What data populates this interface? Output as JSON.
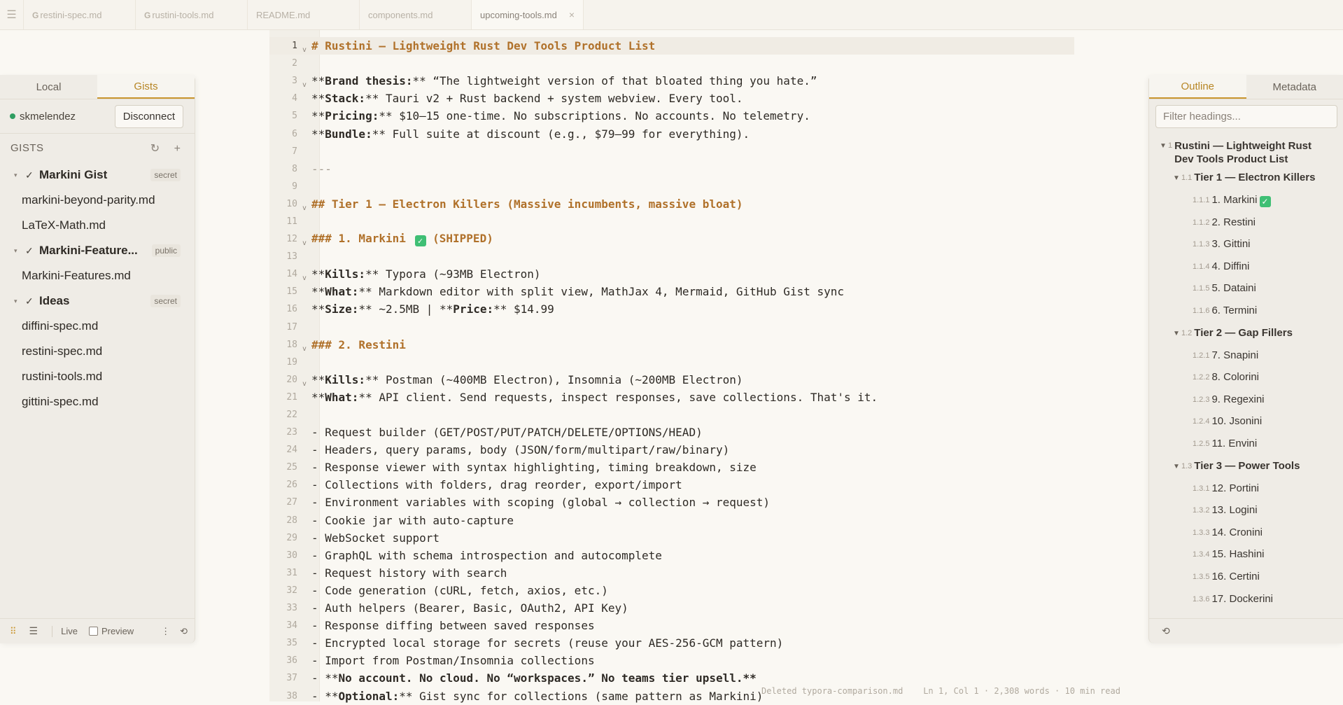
{
  "tabs": [
    {
      "label": "restini-spec.md",
      "gist": true
    },
    {
      "label": "rustini-tools.md",
      "gist": true
    },
    {
      "label": "README.md",
      "gist": false
    },
    {
      "label": "components.md",
      "gist": false
    },
    {
      "label": "upcoming-tools.md",
      "gist": false,
      "active": true
    }
  ],
  "tab_gist_mark": "G",
  "tab_close": "×",
  "left_panel": {
    "tabs": [
      "Local",
      "Gists"
    ],
    "user": "skmelendez",
    "disconnect_label": "Disconnect",
    "gists_title": "GISTS",
    "refresh_icon": "↻",
    "add_icon": "+",
    "groups": [
      {
        "name": "Markini Gist",
        "badge": "secret",
        "files": [
          "markini-beyond-parity.md",
          "LaTeX-Math.md"
        ]
      },
      {
        "name": "Markini-Feature...",
        "badge": "public",
        "files": [
          "Markini-Features.md"
        ]
      },
      {
        "name": "Ideas",
        "badge": "secret",
        "files": [
          "diffini-spec.md",
          "restini-spec.md",
          "rustini-tools.md",
          "gittini-spec.md"
        ]
      }
    ],
    "footer": {
      "live_label": "Live",
      "preview_label": "Preview",
      "more_icon": "⋮"
    }
  },
  "editor": {
    "lines": [
      {
        "t": "h",
        "s": "# Rustini — Lightweight Rust Dev Tools Product List",
        "fold": true
      },
      {
        "t": "p",
        "s": ""
      },
      {
        "t": "kv",
        "k": "Brand thesis:",
        "v": " “The lightweight version of that bloated thing you hate.”",
        "fold": true
      },
      {
        "t": "kv",
        "k": "Stack:",
        "v": " Tauri v2 + Rust backend + system webview. Every tool."
      },
      {
        "t": "kv",
        "k": "Pricing:",
        "v": " $10–15 one-time. No subscriptions. No accounts. No telemetry."
      },
      {
        "t": "kv",
        "k": "Bundle:",
        "v": " Full suite at discount (e.g., $79–99 for everything)."
      },
      {
        "t": "p",
        "s": ""
      },
      {
        "t": "dim",
        "s": "---"
      },
      {
        "t": "p",
        "s": ""
      },
      {
        "t": "h",
        "s": "## Tier 1 — Electron Killers (Massive incumbents, massive bloat)",
        "fold": true
      },
      {
        "t": "p",
        "s": ""
      },
      {
        "t": "hc",
        "a": "### 1. Markini ",
        "b": " (SHIPPED)",
        "fold": true
      },
      {
        "t": "p",
        "s": ""
      },
      {
        "t": "kv",
        "k": "Kills:",
        "v": " Typora (~93MB Electron)",
        "fold": true
      },
      {
        "t": "kv",
        "k": "What:",
        "v": " Markdown editor with split view, MathJax 4, Mermaid, GitHub Gist sync"
      },
      {
        "t": "kv2",
        "k": "Size:",
        "v": " ~2.5MB | ",
        "k2": "Price:",
        "v2": " $14.99"
      },
      {
        "t": "p",
        "s": ""
      },
      {
        "t": "h",
        "s": "### 2. Restini",
        "fold": true
      },
      {
        "t": "p",
        "s": ""
      },
      {
        "t": "kv",
        "k": "Kills:",
        "v": " Postman (~400MB Electron), Insomnia (~200MB Electron)",
        "fold": true
      },
      {
        "t": "kv",
        "k": "What:",
        "v": " API client. Send requests, inspect responses, save collections. That's it."
      },
      {
        "t": "p",
        "s": ""
      },
      {
        "t": "p",
        "s": "- Request builder (GET/POST/PUT/PATCH/DELETE/OPTIONS/HEAD)"
      },
      {
        "t": "p",
        "s": "- Headers, query params, body (JSON/form/multipart/raw/binary)"
      },
      {
        "t": "p",
        "s": "- Response viewer with syntax highlighting, timing breakdown, size"
      },
      {
        "t": "p",
        "s": "- Collections with folders, drag reorder, export/import"
      },
      {
        "t": "p",
        "s": "- Environment variables with scoping (global → collection → request)"
      },
      {
        "t": "p",
        "s": "- Cookie jar with auto-capture"
      },
      {
        "t": "p",
        "s": "- WebSocket support"
      },
      {
        "t": "p",
        "s": "- GraphQL with schema introspection and autocomplete"
      },
      {
        "t": "p",
        "s": "- Request history with search"
      },
      {
        "t": "p",
        "s": "- Code generation (cURL, fetch, axios, etc.)"
      },
      {
        "t": "p",
        "s": "- Auth helpers (Bearer, Basic, OAuth2, API Key)"
      },
      {
        "t": "p",
        "s": "- Response diffing between saved responses"
      },
      {
        "t": "p",
        "s": "- Encrypted local storage for secrets (reuse your AES-256-GCM pattern)"
      },
      {
        "t": "p",
        "s": "- Import from Postman/Insomnia collections"
      },
      {
        "t": "bl",
        "s": "No account. No cloud. No “workspaces.” No teams tier upsell."
      },
      {
        "t": "kvl",
        "k": "Optional:",
        "v": " Gist sync for collections (same pattern as Markini)"
      }
    ],
    "current_line": 1,
    "check_glyph": "✓",
    "status_text": "Deleted typora-comparison.md    Ln 1, Col 1 · 2,308 words · 10 min read"
  },
  "right_panel": {
    "tabs": [
      "Outline",
      "Metadata"
    ],
    "filter_placeholder": "Filter headings...",
    "outline": [
      {
        "lvl": 1,
        "num": "1",
        "text": "Rustini — Lightweight Rust Dev Tools Product List"
      },
      {
        "lvl": 2,
        "num": "1.1",
        "text": "Tier 1 — Electron Killers"
      },
      {
        "lvl": 3,
        "num": "1.1.1",
        "text": "1. Markini",
        "check": true
      },
      {
        "lvl": 3,
        "num": "1.1.2",
        "text": "2. Restini"
      },
      {
        "lvl": 3,
        "num": "1.1.3",
        "text": "3. Gittini"
      },
      {
        "lvl": 3,
        "num": "1.1.4",
        "text": "4. Diffini"
      },
      {
        "lvl": 3,
        "num": "1.1.5",
        "text": "5. Dataini"
      },
      {
        "lvl": 3,
        "num": "1.1.6",
        "text": "6. Termini"
      },
      {
        "lvl": 2,
        "num": "1.2",
        "text": "Tier 2 — Gap Fillers"
      },
      {
        "lvl": 3,
        "num": "1.2.1",
        "text": "7. Snapini"
      },
      {
        "lvl": 3,
        "num": "1.2.2",
        "text": "8. Colorini"
      },
      {
        "lvl": 3,
        "num": "1.2.3",
        "text": "9. Regexini"
      },
      {
        "lvl": 3,
        "num": "1.2.4",
        "text": "10. Jsonini"
      },
      {
        "lvl": 3,
        "num": "1.2.5",
        "text": "11. Envini"
      },
      {
        "lvl": 2,
        "num": "1.3",
        "text": "Tier 3 — Power Tools"
      },
      {
        "lvl": 3,
        "num": "1.3.1",
        "text": "12. Portini"
      },
      {
        "lvl": 3,
        "num": "1.3.2",
        "text": "13. Logini"
      },
      {
        "lvl": 3,
        "num": "1.3.3",
        "text": "14. Cronini"
      },
      {
        "lvl": 3,
        "num": "1.3.4",
        "text": "15. Hashini"
      },
      {
        "lvl": 3,
        "num": "1.3.5",
        "text": "16. Certini"
      },
      {
        "lvl": 3,
        "num": "1.3.6",
        "text": "17. Dockerini"
      }
    ]
  },
  "colors": {
    "accent": "#c9952e",
    "heading": "#b0712a",
    "online": "#2f9e62",
    "check": "#3fbf74"
  }
}
